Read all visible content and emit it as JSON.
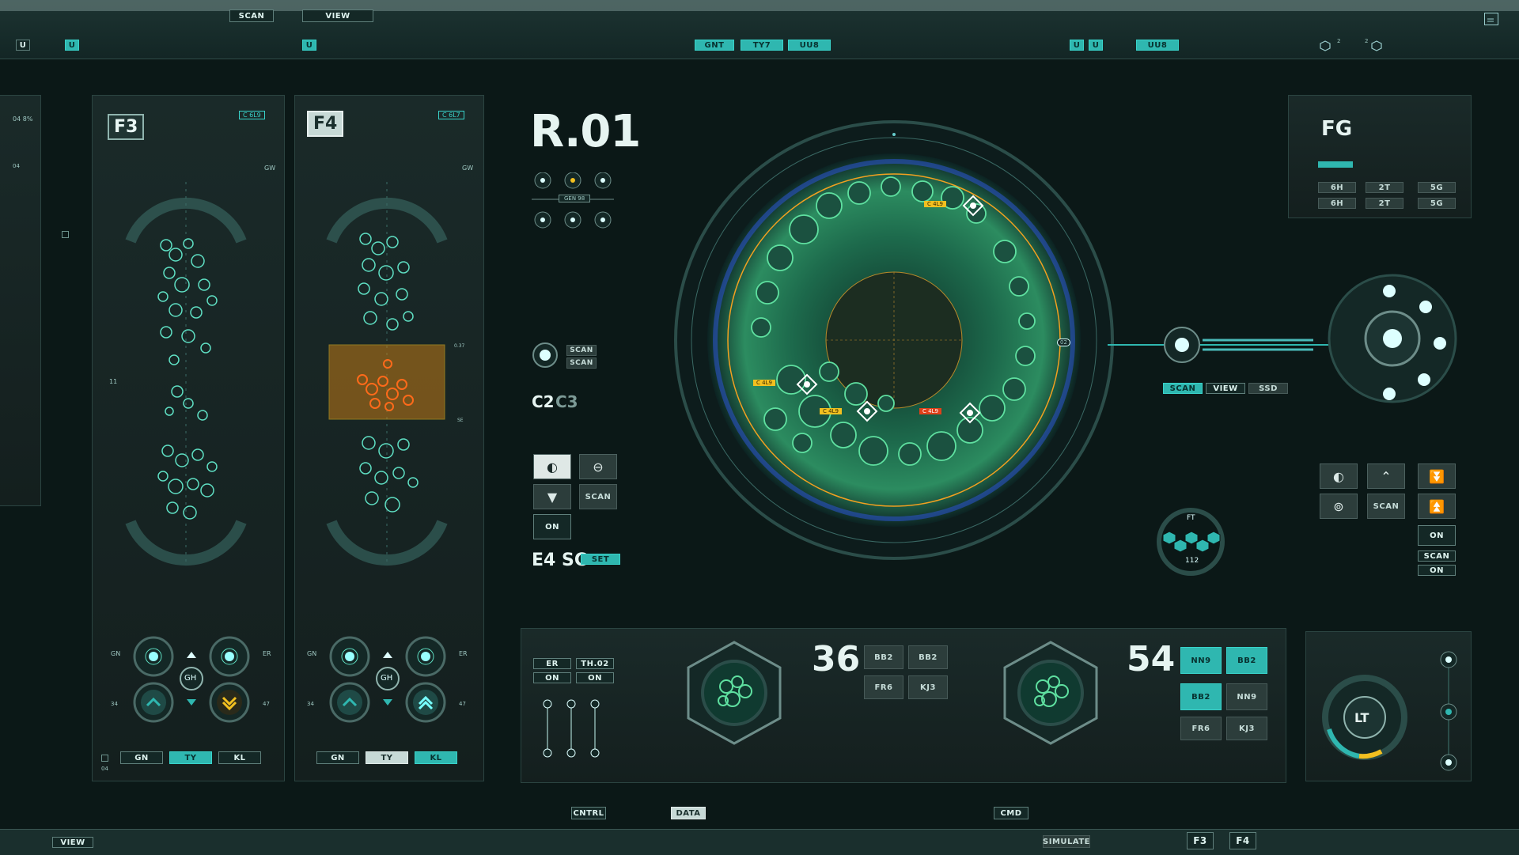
{
  "topbar": {
    "scan": "SCAN",
    "view": "VIEW",
    "u": "U",
    "gnt": "GNT",
    "ty7": "TY7",
    "uu8": "UU8",
    "uu8b": "UU8",
    "n2": "2"
  },
  "panel_f3": {
    "tag": "F3",
    "code": "C 6L9",
    "gw": "GW",
    "gh": "GH",
    "gn_label": "GN",
    "er_label": "ER",
    "n34": "34",
    "n47": "47",
    "tabs": [
      "GN",
      "TY",
      "KL"
    ],
    "n11": "11",
    "n04": "04"
  },
  "panel_f4": {
    "tag": "F4",
    "code": "C 6L7",
    "gw": "GW",
    "gh": "GH",
    "gn_label": "GN",
    "er_label": "ER",
    "n34": "34",
    "n47": "47",
    "tabs": [
      "GN",
      "TY",
      "KL"
    ],
    "m037": "0.37",
    "se": "SE"
  },
  "left_edge": {
    "pct": "04  8%",
    "n04": "04"
  },
  "center": {
    "title": "R.01",
    "gen": "GEN 98",
    "scan1": "SCAN",
    "scan2": "SCAN",
    "c2": "C2",
    "c3": "C3",
    "scan3": "SCAN",
    "on": "ON",
    "e4sc": "E4 SC",
    "set": "SET",
    "er": "ER",
    "th02": "TH.02",
    "on1": "ON",
    "on2": "ON"
  },
  "scope": {
    "labels": [
      "C 4L9",
      "C 4L9",
      "C 4L9",
      "C 4L9"
    ],
    "n02": "02"
  },
  "right": {
    "fg": "FG",
    "grid": [
      [
        "6H",
        "2T",
        "5G"
      ],
      [
        "6H",
        "2T",
        "5G"
      ]
    ],
    "scan": "SCAN",
    "view": "VIEW",
    "ssd": "SSD",
    "ft": "FT",
    "n112": "112",
    "scan2": "SCAN",
    "on1": "ON",
    "scan3": "SCAN",
    "on2": "ON",
    "lt": "LT"
  },
  "bottom_center": {
    "n36": "36",
    "n54": "54",
    "codes_a": [
      "BB2",
      "BB2",
      "FR6",
      "KJ3"
    ],
    "codes_b": [
      "NN9",
      "BB2",
      "BB2",
      "NN9",
      "FR6",
      "KJ3"
    ]
  },
  "bottombar": {
    "view": "VIEW",
    "cntrl": "CNTRL",
    "data": "DATA",
    "cmd": "CMD",
    "simulate": "SIMULATE",
    "f3": "F3",
    "f4": "F4"
  },
  "colors": {
    "accent": "#2fb7b0",
    "green": "#3ee0a0",
    "orange": "#ff7a1a",
    "yellow": "#f2c020",
    "red": "#e0401a"
  }
}
